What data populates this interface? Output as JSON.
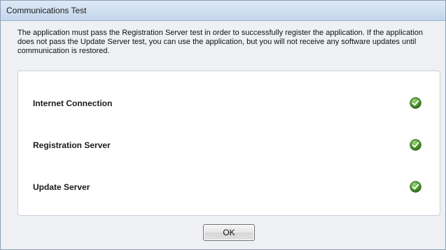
{
  "window": {
    "title": "Communications Test"
  },
  "message": "The application must pass the Registration Server test in order to successfully register the application. If the application does not pass the Update Server test, you can use the application, but you will not receive any software updates until communication is restored.",
  "tests": [
    {
      "label": "Internet Connection",
      "status_icon": "check-circle-icon"
    },
    {
      "label": "Registration Server",
      "status_icon": "check-circle-icon"
    },
    {
      "label": "Update Server",
      "status_icon": "check-circle-icon"
    }
  ],
  "buttons": {
    "ok_label": "OK"
  },
  "colors": {
    "success": "#4c9a2a"
  }
}
